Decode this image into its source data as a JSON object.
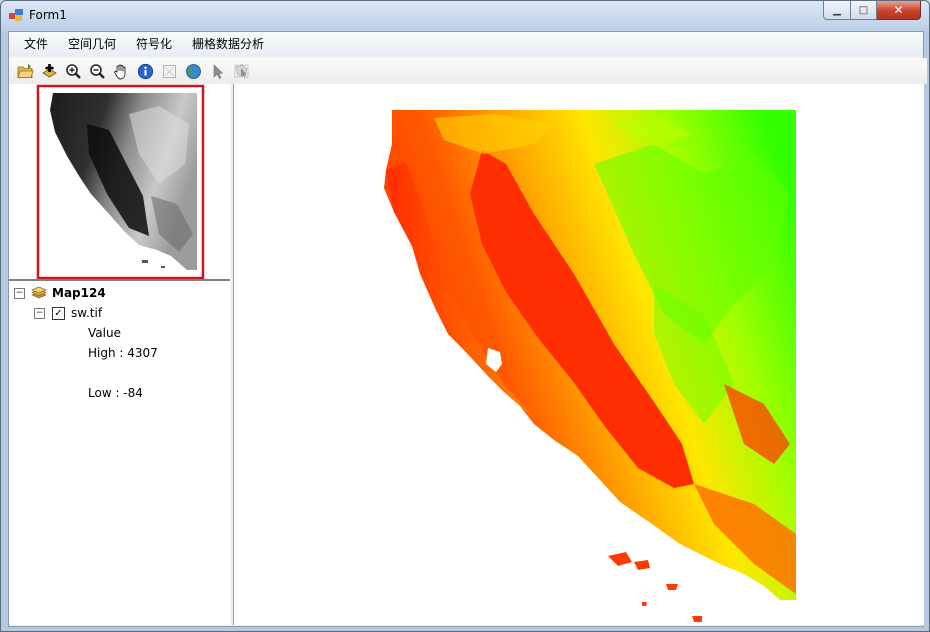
{
  "window": {
    "title": "Form1",
    "caption_buttons": {
      "minimize": "▁",
      "maximize": "□",
      "close": "✕"
    }
  },
  "menu": [
    {
      "label": "文件"
    },
    {
      "label": "空间几何"
    },
    {
      "label": "符号化"
    },
    {
      "label": "栅格数据分析"
    }
  ],
  "toolbar": [
    {
      "icon": "open-folder-icon"
    },
    {
      "icon": "add-data-icon"
    },
    {
      "icon": "zoom-in-icon"
    },
    {
      "icon": "zoom-out-icon"
    },
    {
      "icon": "pan-hand-icon"
    },
    {
      "icon": "identify-icon"
    },
    {
      "icon": "full-extent-icon"
    },
    {
      "icon": "globe-icon"
    },
    {
      "icon": "select-arrow-icon"
    },
    {
      "icon": "select-features-icon"
    }
  ],
  "toc": {
    "expand_glyph": "−",
    "check_glyph": "✓",
    "map": "Map124",
    "layer": "sw.tif",
    "legend_title": "Value",
    "high": "High : 4307",
    "low": "Low : -84"
  },
  "colors": {
    "overview_extent": "#c8181c",
    "raster_low": "#ff2a00",
    "raster_mid": "#ffe600",
    "raster_high": "#33ff00"
  }
}
